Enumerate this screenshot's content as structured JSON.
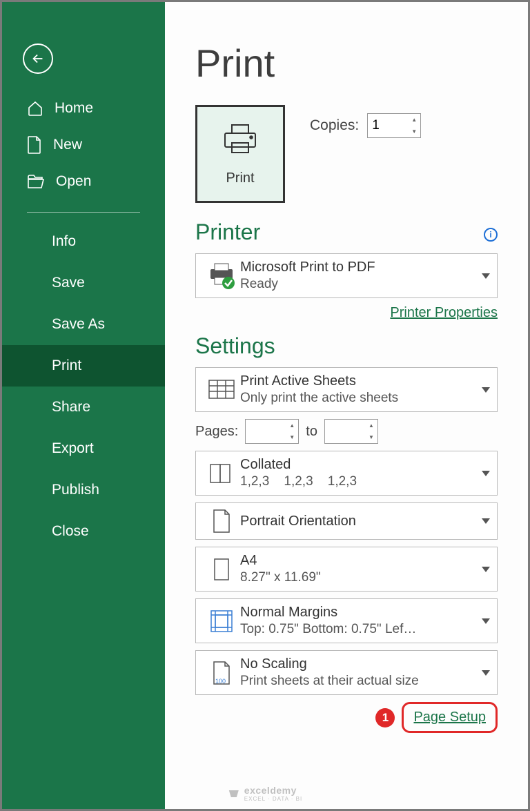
{
  "page_title": "Print",
  "sidebar": {
    "top": [
      {
        "label": "Home"
      },
      {
        "label": "New"
      },
      {
        "label": "Open"
      }
    ],
    "sub": [
      {
        "label": "Info"
      },
      {
        "label": "Save"
      },
      {
        "label": "Save As"
      },
      {
        "label": "Print",
        "active": true
      },
      {
        "label": "Share"
      },
      {
        "label": "Export"
      },
      {
        "label": "Publish"
      },
      {
        "label": "Close"
      }
    ]
  },
  "print_button": "Print",
  "copies": {
    "label": "Copies:",
    "value": "1"
  },
  "printer": {
    "heading": "Printer",
    "name": "Microsoft Print to PDF",
    "status": "Ready",
    "properties_link": "Printer Properties"
  },
  "settings": {
    "heading": "Settings",
    "pages_label": "Pages:",
    "pages_to": "to",
    "items": [
      {
        "title": "Print Active Sheets",
        "sub": "Only print the active sheets"
      },
      {
        "title": "Collated",
        "sub": "1,2,3    1,2,3    1,2,3"
      },
      {
        "title": "Portrait Orientation",
        "sub": ""
      },
      {
        "title": "A4",
        "sub": "8.27\" x 11.69\""
      },
      {
        "title": "Normal Margins",
        "sub": "Top: 0.75\" Bottom: 0.75\" Lef…"
      },
      {
        "title": "No Scaling",
        "sub": "Print sheets at their actual size"
      }
    ],
    "page_setup_link": "Page Setup"
  },
  "annotation": {
    "badge": "1"
  },
  "watermark": {
    "brand": "exceldemy",
    "tagline": "EXCEL · DATA · BI"
  }
}
